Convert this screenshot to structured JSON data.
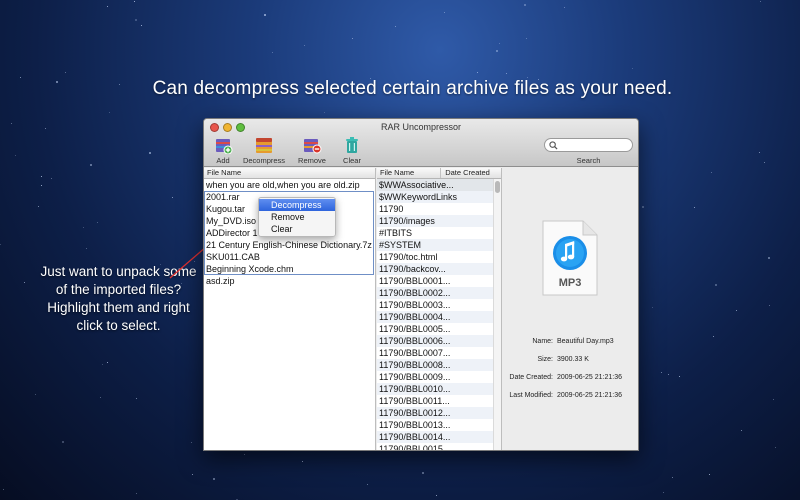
{
  "headline": "Can decompress selected certain archive files as your need.",
  "annotation": "Just want to unpack some of the imported files? Highlight them and right click to select.",
  "window": {
    "title": "RAR Uncompressor",
    "toolbar": {
      "add": "Add",
      "decompress": "Decompress",
      "remove": "Remove",
      "clear": "Clear",
      "search": "Search"
    }
  },
  "left_pane": {
    "header": "File Name",
    "files": [
      "when you are old,when you are old.zip",
      "2001.rar",
      "Kugou.tar",
      "My_DVD.iso",
      "ADDirector 1",
      "21 Century English-Chinese Dictionary.7z",
      "SKU011.CAB",
      "Beginning Xcode.chm",
      "asd.zip"
    ]
  },
  "context_menu": {
    "items": [
      "Decompress",
      "Remove",
      "Clear"
    ],
    "highlighted": "Decompress"
  },
  "mid_pane": {
    "header_name": "File Name",
    "header_date": "Date Created",
    "entries": [
      "$WWAssociative...",
      "$WWKeywordLinks",
      "11790",
      "11790/images",
      "#ITBITS",
      "#SYSTEM",
      "11790/toc.html",
      "11790/backcov...",
      "11790/BBL0001...",
      "11790/BBL0002...",
      "11790/BBL0003...",
      "11790/BBL0004...",
      "11790/BBL0005...",
      "11790/BBL0006...",
      "11790/BBL0007...",
      "11790/BBL0008...",
      "11790/BBL0009...",
      "11790/BBL0010...",
      "11790/BBL0011...",
      "11790/BBL0012...",
      "11790/BBL0013...",
      "11790/BBL0014...",
      "11790/BBL0015..."
    ]
  },
  "preview": {
    "file_type": "MP3",
    "name_label": "Name:",
    "name_value": "Beautiful Day.mp3",
    "size_label": "Size:",
    "size_value": "3900.33 K",
    "created_label": "Date Created:",
    "created_value": "2009-06-25 21:21:36",
    "modified_label": "Last Modified:",
    "modified_value": "2009-06-25 21:21:36"
  },
  "colors": {
    "highlight": "#2e64dc",
    "annotation_arrow": "#e03030",
    "itunes_blue": "#1a8ee8"
  },
  "icons": [
    "add-archive-icon",
    "decompress-icon",
    "remove-icon",
    "clear-icon",
    "search-icon",
    "music-note-icon"
  ]
}
